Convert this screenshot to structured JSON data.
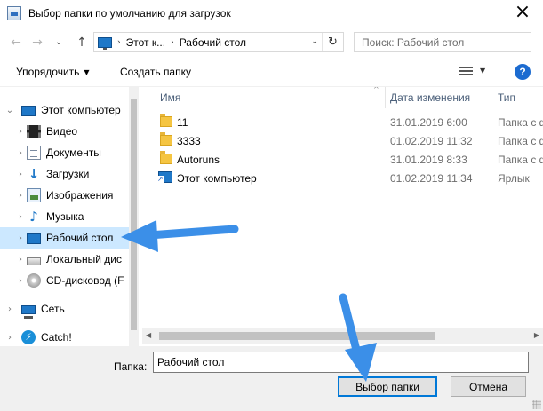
{
  "window": {
    "title": "Выбор папки по умолчанию для загрузок",
    "close_glyph": "×"
  },
  "nav": {
    "back_glyph": "←",
    "forward_glyph": "→",
    "recent_glyph": "⌄",
    "up_glyph": "↑",
    "breadcrumb": [
      "Этот к...",
      "Рабочий стол"
    ],
    "crumb_sep": "›",
    "dropdown_glyph": "⌄",
    "refresh_glyph": "↻",
    "search_placeholder": "Поиск: Рабочий стол"
  },
  "toolbar": {
    "organize": "Упорядочить",
    "organize_arrow": "▼",
    "new_folder": "Создать папку",
    "view_arrow": "▼",
    "help": "?"
  },
  "tree": {
    "chev_open": "⌄",
    "chev_closed": "›",
    "items": [
      {
        "label": "Этот компьютер",
        "icon": "computer-icon"
      },
      {
        "label": "Видео",
        "icon": "video-icon"
      },
      {
        "label": "Документы",
        "icon": "documents-icon"
      },
      {
        "label": "Загрузки",
        "icon": "downloads-icon",
        "glyph": "↓"
      },
      {
        "label": "Изображения",
        "icon": "pictures-icon"
      },
      {
        "label": "Музыка",
        "icon": "music-icon",
        "glyph": "♪"
      },
      {
        "label": "Рабочий стол",
        "icon": "desktop-icon"
      },
      {
        "label": "Локальный дис",
        "icon": "local-disk-icon"
      },
      {
        "label": "CD-дисковод (F",
        "icon": "cd-drive-icon"
      },
      {
        "label": "Сеть",
        "icon": "network-icon"
      },
      {
        "label": "Catch!",
        "icon": "catch-icon",
        "glyph": "⚡"
      }
    ]
  },
  "files": {
    "columns": {
      "name": "Имя",
      "date": "Дата изменения",
      "type": "Тип"
    },
    "sort_glyph": "^",
    "rows": [
      {
        "name": "11",
        "date": "31.01.2019 6:00",
        "type": "Папка с ф",
        "icon": "folder-icon"
      },
      {
        "name": "3333",
        "date": "01.02.2019 11:32",
        "type": "Папка с ф",
        "icon": "folder-icon"
      },
      {
        "name": "Autoruns",
        "date": "31.01.2019 8:33",
        "type": "Папка с ф",
        "icon": "folder-icon"
      },
      {
        "name": "Этот компьютер",
        "date": "01.02.2019 11:34",
        "type": "Ярлык",
        "icon": "shortcut-icon"
      }
    ]
  },
  "hscroll": {
    "left_glyph": "◀",
    "right_glyph": "▶"
  },
  "footer": {
    "folder_label": "Папка:",
    "folder_value": "Рабочий стол",
    "select_button": "Выбор папки",
    "cancel_button": "Отмена"
  },
  "colors": {
    "accent": "#0078d7",
    "selection": "#cce8ff",
    "annotation_arrow": "#3b8fe8"
  }
}
